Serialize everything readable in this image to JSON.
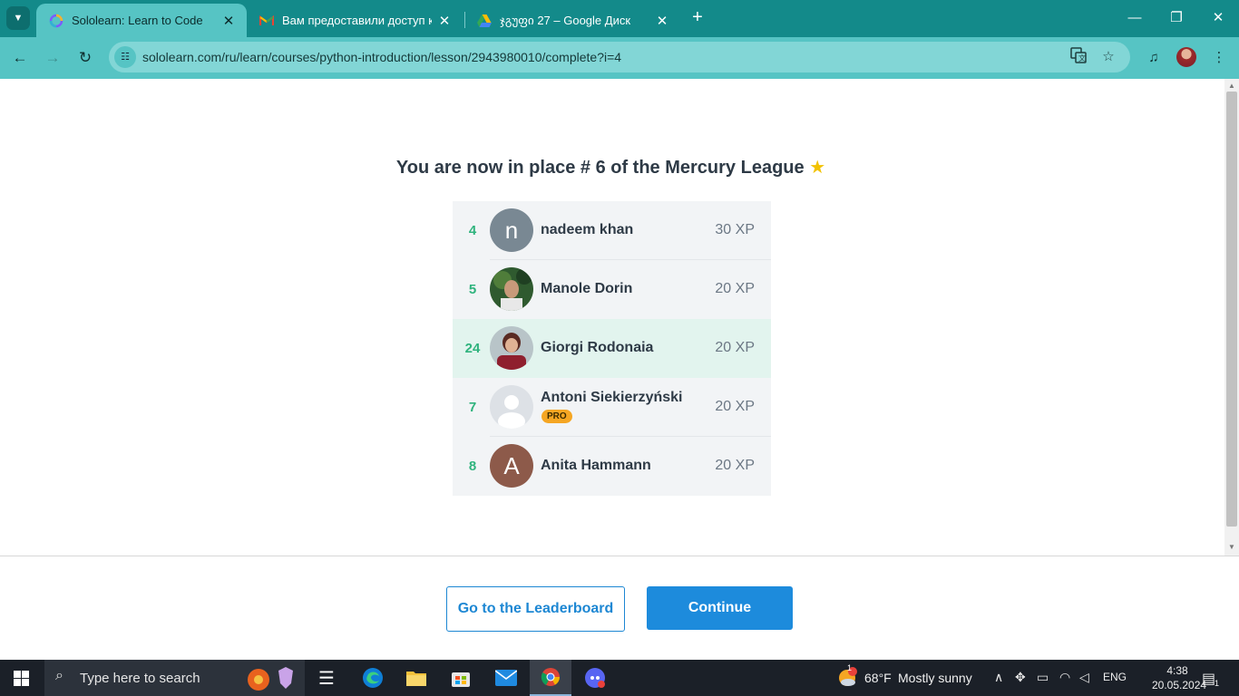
{
  "browser": {
    "tabs": [
      {
        "title": "Sololearn: Learn to Code",
        "active": true
      },
      {
        "title": "Вам предоставили доступ к папке",
        "active": false
      },
      {
        "title": "ჯგუფი 27 – Google Диск",
        "active": false
      }
    ],
    "new_tab": "+",
    "url": "sololearn.com/ru/learn/courses/python-introduction/lesson/2943980010/complete?i=4"
  },
  "page": {
    "headline": "You are now in place # 6 of the Mercury  League",
    "headline_icon": "★",
    "leaderboard": [
      {
        "rank": "4",
        "name": "nadeem khan",
        "xp": "30 XP",
        "avatar_letter": "n",
        "avatar_color": "#798893",
        "pro": ""
      },
      {
        "rank": "5",
        "name": "Manole Dorin",
        "xp": "20 XP",
        "avatar_letter": "",
        "avatar_color": "#2f5a2f",
        "pro": ""
      },
      {
        "rank": "24",
        "name": "Giorgi Rodonaia",
        "xp": "20 XP",
        "avatar_letter": "",
        "avatar_color": "#7a2a2e",
        "pro": "",
        "highlight": true
      },
      {
        "rank": "7",
        "name": "Antoni Siekierzyński",
        "xp": "20 XP",
        "avatar_letter": "",
        "avatar_color": "#dde1e6",
        "pro": "PRO"
      },
      {
        "rank": "8",
        "name": "Anita Hammann",
        "xp": "20 XP",
        "avatar_letter": "A",
        "avatar_color": "#8d5a4a",
        "pro": ""
      }
    ],
    "accent_color": "#2fb37d",
    "highlight_color": "#e2f4ee"
  },
  "actions": {
    "leaderboard_button": "Go to the Leaderboard",
    "continue_button": "Continue",
    "button_color": "#1d8bdc"
  },
  "taskbar": {
    "search_placeholder": "Type here to search",
    "weather_temp": "68°F",
    "weather_text": "Mostly sunny",
    "weather_badge": "1",
    "language": "ENG",
    "time": "4:38",
    "date": "20.05.2024",
    "notification_count": "1"
  }
}
